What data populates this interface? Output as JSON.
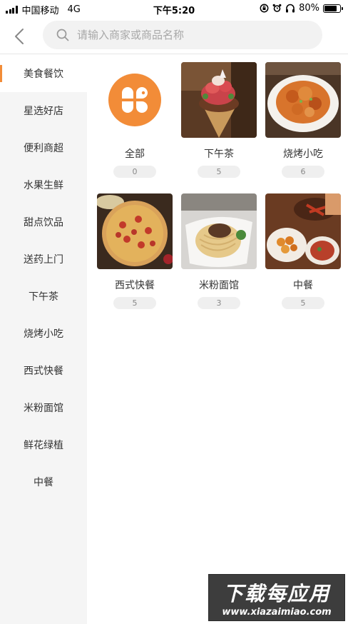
{
  "status_bar": {
    "carrier": "中国移动",
    "network": "4G",
    "time": "下午5:20",
    "battery": "80%",
    "battery_level": 0.8
  },
  "header": {
    "search_placeholder": "请输入商家或商品名称"
  },
  "sidebar": {
    "items": [
      {
        "label": "美食餐饮",
        "active": true
      },
      {
        "label": "星选好店"
      },
      {
        "label": "便利商超"
      },
      {
        "label": "水果生鲜"
      },
      {
        "label": "甜点饮品"
      },
      {
        "label": "送药上门"
      },
      {
        "label": "下午茶"
      },
      {
        "label": "烧烤小吃"
      },
      {
        "label": "西式快餐"
      },
      {
        "label": "米粉面馆"
      },
      {
        "label": "鲜花绿植"
      },
      {
        "label": "中餐"
      }
    ]
  },
  "categories": [
    {
      "name": "全部",
      "count": "0",
      "icon": "all-clover-icon"
    },
    {
      "name": "下午茶",
      "count": "5",
      "icon": "afternoon-tea-photo"
    },
    {
      "name": "烧烤小吃",
      "count": "6",
      "icon": "bbq-snack-photo"
    },
    {
      "name": "西式快餐",
      "count": "5",
      "icon": "pizza-photo"
    },
    {
      "name": "米粉面馆",
      "count": "3",
      "icon": "noodles-photo"
    },
    {
      "name": "中餐",
      "count": "5",
      "icon": "chinese-food-photo"
    }
  ],
  "watermark": {
    "title": "下载每应用",
    "url": "www.xiazaimiao.com"
  },
  "colors": {
    "accent": "#f28c38",
    "sidebar_bg": "#f5f5f5",
    "count_badge_bg": "#efefef"
  }
}
